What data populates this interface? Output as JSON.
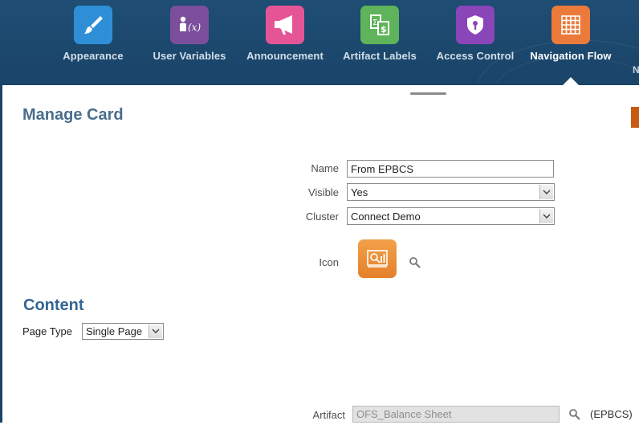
{
  "nav": {
    "items": [
      {
        "label": "Appearance",
        "icon": "paintbrush-icon",
        "color": "#2e8fd7"
      },
      {
        "label": "User Variables",
        "icon": "user-variable-icon",
        "color": "#7b4e9c"
      },
      {
        "label": "Announcement",
        "icon": "megaphone-icon",
        "color": "#e55596"
      },
      {
        "label": "Artifact Labels",
        "icon": "artifact-labels-icon",
        "color": "#5fb35a"
      },
      {
        "label": "Access Control",
        "icon": "shield-lock-icon",
        "color": "#8a45b8"
      },
      {
        "label": "Navigation Flow",
        "icon": "grid-icon",
        "color": "#ec7a3a"
      }
    ],
    "active_index": 5,
    "edge_text": "N"
  },
  "manage_card": {
    "title": "Manage Card",
    "name_label": "Name",
    "name_value": "From EPBCS",
    "visible_label": "Visible",
    "visible_value": "Yes",
    "cluster_label": "Cluster",
    "cluster_value": "Connect Demo",
    "icon_label": "Icon",
    "icon_name": "report-magnifier-icon",
    "icon_color": "#ec8a36"
  },
  "content": {
    "title": "Content",
    "page_type_label": "Page Type",
    "page_type_value": "Single Page",
    "artifact_label": "Artifact",
    "artifact_value": "OFS_Balance Sheet",
    "artifact_source": "(EPBCS)"
  }
}
